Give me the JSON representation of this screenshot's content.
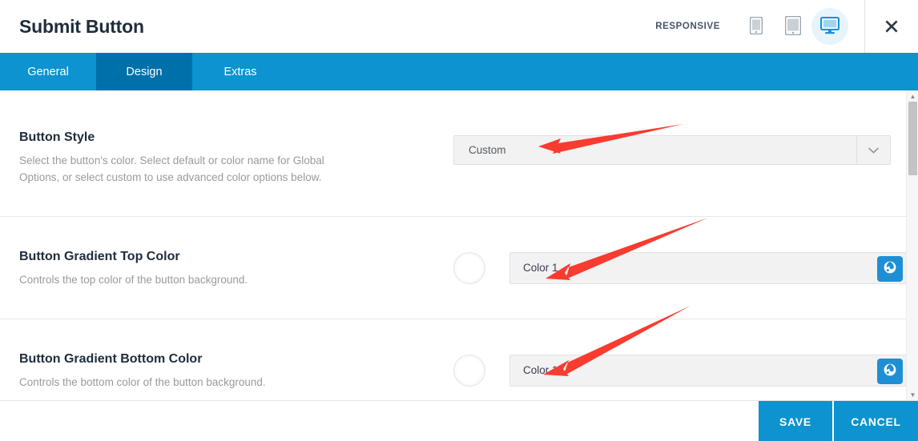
{
  "header": {
    "title": "Submit Button",
    "responsive_label": "RESPONSIVE",
    "devices": [
      {
        "name": "phone",
        "label": "Phone",
        "active": false
      },
      {
        "name": "tablet",
        "label": "Tablet",
        "active": false
      },
      {
        "name": "desktop",
        "label": "Desktop",
        "active": true
      }
    ],
    "close_label": "Close"
  },
  "tabs": [
    {
      "label": "General",
      "active": false
    },
    {
      "label": "Design",
      "active": true
    },
    {
      "label": "Extras",
      "active": false
    }
  ],
  "settings": [
    {
      "title": "Button Style",
      "description": "Select the button's color. Select default or color name for Global Options, or select custom to use advanced color options below.",
      "control": "select",
      "value": "Custom"
    },
    {
      "title": "Button Gradient Top Color",
      "description": "Controls the top color of the button background.",
      "control": "color",
      "value": "Color 1",
      "swatch_color": "#ffffff"
    },
    {
      "title": "Button Gradient Bottom Color",
      "description": "Controls the bottom color of the button background.",
      "control": "color",
      "value": "Color 1",
      "swatch_color": "#ffffff"
    }
  ],
  "footer": {
    "save_label": "SAVE",
    "cancel_label": "CANCEL"
  },
  "colors": {
    "tabbar_blue": "#0c93d0",
    "active_tab_blue": "#0070ab",
    "globe_button_blue": "#1e8fd5",
    "annotation_red": "#f93b30",
    "device_active_bg": "#e8f4fc"
  },
  "annotations": [
    {
      "name": "arrow-to-button-style-select",
      "color": "#f93b30"
    },
    {
      "name": "arrow-to-gradient-top-color-field",
      "color": "#f93b30"
    },
    {
      "name": "arrow-to-gradient-bottom-color-field",
      "color": "#f93b30"
    }
  ]
}
